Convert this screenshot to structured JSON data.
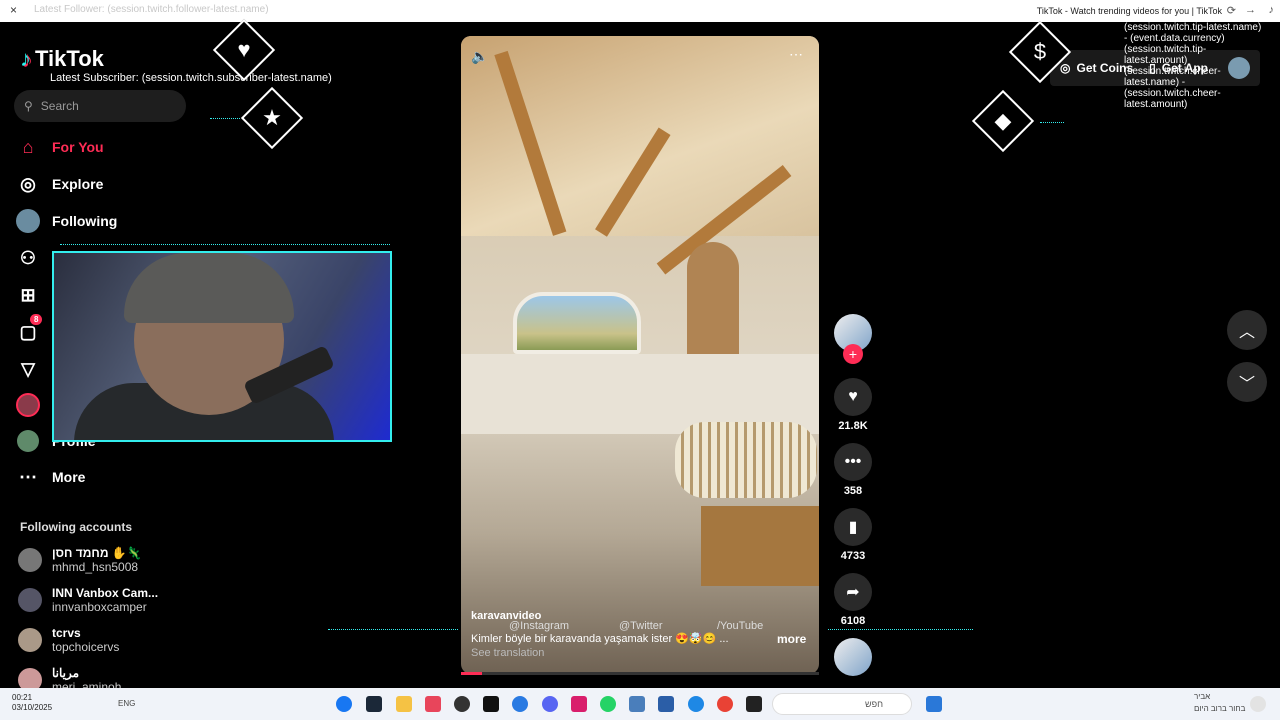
{
  "window": {
    "close_icon": "×",
    "ghost_text": "Latest Follower: (session.twitch.follower-latest.name)",
    "title": "TikTok - Watch trending videos for you | TikTok"
  },
  "sidebar": {
    "logo": "TikTok",
    "latest_subscriber": "Latest Subscriber: (session.twitch.subscriber-latest.name)",
    "search_placeholder": "Search",
    "nav": [
      {
        "label": "For You",
        "icon": "home-icon"
      },
      {
        "label": "Explore",
        "icon": "compass-icon"
      },
      {
        "label": "Following",
        "icon": "following-avatar"
      },
      {
        "label": "",
        "icon": "friends-icon"
      },
      {
        "label": "",
        "icon": "upload-icon"
      },
      {
        "label": "",
        "icon": "messages-icon",
        "badge": "8"
      },
      {
        "label": "",
        "icon": "send-icon"
      },
      {
        "label": "",
        "icon": "live-avatar"
      },
      {
        "label": "Profile",
        "icon": "profile-avatar"
      },
      {
        "label": "More",
        "icon": "more-icon"
      }
    ],
    "following_title": "Following accounts",
    "accounts": [
      {
        "name": "מחמד חסן ✋🦎",
        "handle": "mhmd_hsn5008"
      },
      {
        "name": "INN Vanbox Cam...",
        "handle": "innvanboxcamper"
      },
      {
        "name": "tcrvs",
        "handle": "topchoicervs"
      },
      {
        "name": "مریانا",
        "handle": "meri_aminoh"
      }
    ]
  },
  "video": {
    "username": "karavanvideo",
    "caption": "Kimler böyle bir karavanda yaşamak ister 😍🤯😊 ...",
    "more": "more",
    "see_translation": "See translation",
    "socials": [
      "@Instagram",
      "@Twitter",
      "/YouTube"
    ],
    "progress": 0.06
  },
  "actions": {
    "likes": "21.8K",
    "comments": "358",
    "saves": "4733",
    "shares": "6108"
  },
  "topright": {
    "get_coins": "Get Coins",
    "get_app": "Get App"
  },
  "alerts": {
    "tip": "(session.twitch.tip-latest.name) - (event.data.currency)(session.twitch.tip-latest.amount)",
    "cheer": "(session.twitch.cheer-latest.name) - (session.twitch.cheer-latest.amount)"
  },
  "taskbar": {
    "time": "00:21",
    "date": "03/10/2025",
    "lang": "ENG",
    "search": "חפש",
    "weather": "בחור ברוב היום",
    "weather_title": "אביר"
  },
  "colors": {
    "accent": "#fe2c55",
    "overlay": "#33eeee",
    "bg": "#000000"
  }
}
